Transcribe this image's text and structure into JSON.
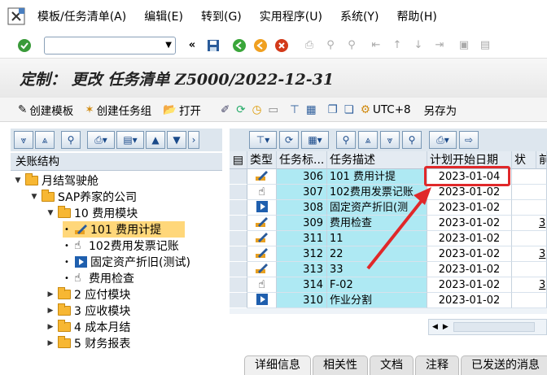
{
  "menubar": {
    "items": [
      "模板/任务清单(A)",
      "编辑(E)",
      "转到(G)",
      "实用程序(U)",
      "系统(Y)",
      "帮助(H)"
    ]
  },
  "title": "定制： 更改 任务清单 Z5000/2022-12-31",
  "toolbar": {
    "create_template": "创建模板",
    "create_task_group": "创建任务组",
    "open": "打开",
    "utc": "UTC+8",
    "save_as": "另存为"
  },
  "tree": {
    "header": "关账结构",
    "nodes": [
      {
        "label": "月结驾驶舱"
      },
      {
        "label": "SAP养家的公司"
      },
      {
        "label": "10 费用模块"
      },
      {
        "label": "101 费用计提"
      },
      {
        "label": "102费用发票记账"
      },
      {
        "label": "固定资产折旧(测试)"
      },
      {
        "label": "费用检查"
      },
      {
        "label": "2 应付模块"
      },
      {
        "label": "3 应收模块"
      },
      {
        "label": "4 成本月结"
      },
      {
        "label": "5 财务报表"
      }
    ]
  },
  "grid": {
    "columns": [
      "类型",
      "任务标...",
      "任务描述",
      "计划开始日期",
      "状",
      "前"
    ],
    "rows": [
      {
        "type": "edit-icon",
        "num": "306",
        "desc": "101 费用计提",
        "date": "2023-01-04",
        "extra": ""
      },
      {
        "type": "hand-icon",
        "num": "307",
        "desc": "102费用发票记账",
        "date": "2023-01-02",
        "extra": ""
      },
      {
        "type": "play-icon",
        "num": "308",
        "desc": "固定资产折旧(测",
        "date": "2023-01-02",
        "extra": ""
      },
      {
        "type": "edit-icon",
        "num": "309",
        "desc": "费用检查",
        "date": "2023-01-02",
        "extra": "3"
      },
      {
        "type": "edit-icon",
        "num": "311",
        "desc": "11",
        "date": "2023-01-02",
        "extra": ""
      },
      {
        "type": "edit-icon",
        "num": "312",
        "desc": "22",
        "date": "2023-01-02",
        "extra": "3"
      },
      {
        "type": "edit-icon",
        "num": "313",
        "desc": "33",
        "date": "2023-01-02",
        "extra": ""
      },
      {
        "type": "hand-icon",
        "num": "314",
        "desc": "F-02",
        "date": "2023-01-02",
        "extra": "3"
      },
      {
        "type": "play-icon",
        "num": "310",
        "desc": "作业分割",
        "date": "2023-01-02",
        "extra": ""
      }
    ]
  },
  "tabs": [
    "详细信息",
    "相关性",
    "文档",
    "注释",
    "已发送的消息"
  ],
  "colors": {
    "cell_highlight": "#aee9f3",
    "selected_node": "#ffd77a",
    "annotation_red": "#e0282a"
  }
}
